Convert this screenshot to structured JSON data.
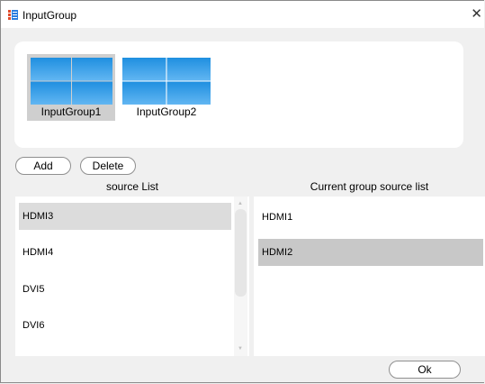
{
  "window": {
    "title": "InputGroup",
    "close_glyph": "✕"
  },
  "groups": [
    {
      "label": "InputGroup1",
      "selected": true
    },
    {
      "label": "InputGroup2",
      "selected": false
    }
  ],
  "actions": {
    "add_label": "Add",
    "delete_label": "Delete"
  },
  "source_list": {
    "header": "source List",
    "items": [
      "HDMI3",
      "HDMI4",
      "DVI5",
      "DVI6"
    ],
    "selected": "HDMI3"
  },
  "current_list": {
    "header": "Current group source list",
    "items": [
      "HDMI1",
      "HDMI2"
    ],
    "selected": "HDMI2"
  },
  "footer": {
    "ok_label": "Ok"
  },
  "colors": {
    "tile_top": "#1f8fe0",
    "tile_bottom": "#62b6f2",
    "app_icon_left": "#e04a2a",
    "app_icon_right": "#2a7de0"
  },
  "icons": [
    "app-icon",
    "close-icon",
    "video-wall-icon"
  ]
}
